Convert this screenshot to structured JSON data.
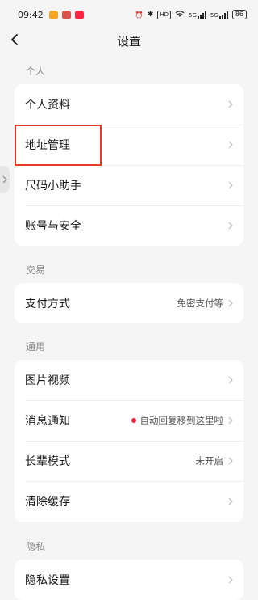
{
  "status_bar": {
    "time": "09:42",
    "hd_label": "HD",
    "network_1": "5G",
    "network_2": "5G",
    "battery": "86"
  },
  "header": {
    "title": "设置"
  },
  "sections": [
    {
      "label": "个人",
      "items": [
        {
          "label": "个人资料",
          "value": ""
        },
        {
          "label": "地址管理",
          "value": ""
        },
        {
          "label": "尺码小助手",
          "value": ""
        },
        {
          "label": "账号与安全",
          "value": ""
        }
      ]
    },
    {
      "label": "交易",
      "items": [
        {
          "label": "支付方式",
          "value": "免密支付等"
        }
      ]
    },
    {
      "label": "通用",
      "items": [
        {
          "label": "图片视频",
          "value": ""
        },
        {
          "label": "消息通知",
          "value": "自动回复移到这里啦"
        },
        {
          "label": "长辈模式",
          "value": "未开启"
        },
        {
          "label": "清除缓存",
          "value": ""
        }
      ]
    },
    {
      "label": "隐私",
      "items": [
        {
          "label": "隐私设置",
          "value": ""
        }
      ]
    }
  ],
  "colors": {
    "accent": "#ff2442",
    "highlight_box": "#e8392f",
    "background": "#f5f5f5"
  },
  "icons": [
    "back-icon",
    "chevron-right-icon",
    "alarm-icon",
    "wifi-icon",
    "signal-icon",
    "bluetooth-icon"
  ]
}
